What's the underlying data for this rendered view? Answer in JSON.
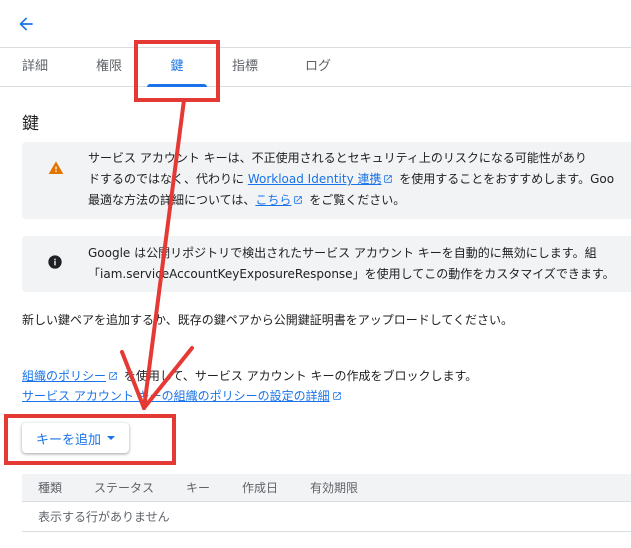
{
  "topbar": {
    "back_icon": "arrow-back-icon"
  },
  "tabs": [
    {
      "label": "詳細",
      "active": false
    },
    {
      "label": "権限",
      "active": false
    },
    {
      "label": "鍵",
      "active": true
    },
    {
      "label": "指標",
      "active": false
    },
    {
      "label": "ログ",
      "active": false
    }
  ],
  "page": {
    "title": "鍵"
  },
  "warning_notice": {
    "icon": "warning-icon",
    "line1": "サービス アカウント キーは、不正使用されるとセキュリティ上のリスクになる可能性があり",
    "line2_pre": "ドするのではなく、代わりに ",
    "line2_link": "Workload Identity 連携",
    "line2_post": " を使用することをおすすめします。Goo",
    "line3_pre": "最適な方法の詳細については、",
    "line3_link": "こちら",
    "line3_post": " をご覧ください。"
  },
  "info_notice": {
    "icon": "info-icon",
    "line1": "Google は公開リポジトリで検出されたサービス アカウント キーを自動的に無効にします。組",
    "line2": "「iam.serviceAccountKeyExposureResponse」を使用してこの動作をカスタマイズできます。"
  },
  "description": "新しい鍵ペアを追加するか、既存の鍵ペアから公開鍵証明書をアップロードしてください。",
  "policy": {
    "link1": "組織のポリシー",
    "text1": " を使用して、サービス アカウント キーの作成をブロックします。",
    "link2": "サービス アカウント キーの組織のポリシーの設定の詳細"
  },
  "add_key_button": {
    "label": "キーを追加"
  },
  "table": {
    "columns": [
      "種類",
      "ステータス",
      "キー",
      "作成日",
      "有効期限"
    ],
    "empty_message": "表示する行がありません"
  },
  "colors": {
    "accent": "#1a73e8",
    "warning": "#e37400",
    "annotation": "#e53935"
  }
}
